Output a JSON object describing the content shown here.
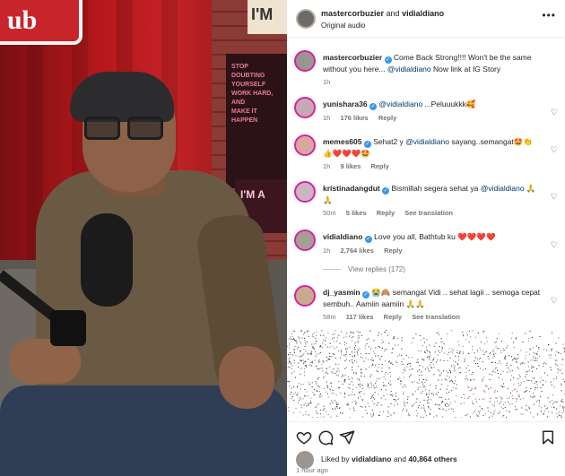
{
  "colors": {
    "text": "#262626",
    "secondary": "#737373",
    "mention": "#00376b",
    "verified": "#3897f0",
    "heart_red": "#ed1d25"
  },
  "media": {
    "left_sign_text": "ub",
    "right_sign_text": "I'M",
    "poster_text": [
      "STOP DOUBTING",
      "YOURSELF",
      "WORK HARD, AND",
      "MAKE IT HAPPEN"
    ],
    "poster2_text": "I'M A"
  },
  "header": {
    "user1": "mastercorbuzier",
    "and": "and",
    "user2": "vidialdiano",
    "audio_label": "Original audio",
    "more_icon": "more-horizontal-icon"
  },
  "caption": {
    "username": "mastercorbuzier",
    "text_before": "Come Back Strong!!!! Won't be the same without you here...",
    "mention": "@vidialdiano",
    "text_after": "Now link at IG Story",
    "time": "1h"
  },
  "comments": [
    {
      "username": "yunishara36",
      "verified": true,
      "mention": "@vidialdiano",
      "text": "...Peluuukkk🥰",
      "time": "1h",
      "likes": "176 likes",
      "reply": "Reply",
      "translation": ""
    },
    {
      "username": "memes605",
      "verified": true,
      "text_before": "Sehat2 y",
      "mention": "@vidialdiano",
      "text": "sayang..semangat🤩👏",
      "line2": "👍❤️❤️❤️🤩",
      "time": "1h",
      "likes": "9 likes",
      "reply": "Reply",
      "translation": ""
    },
    {
      "username": "kristinadangdut",
      "verified": true,
      "text_before": "Bismillah segera sehat ya",
      "mention": "@vidialdiano",
      "text": "🙏",
      "line2": "🙏",
      "time": "50m",
      "likes": "5 likes",
      "reply": "Reply",
      "translation": "See translation"
    },
    {
      "username": "vidialdiano",
      "verified": true,
      "text": "Love you all, Bathtub ku ❤️❤️❤️❤️",
      "time": "1h",
      "likes": "2,764 likes",
      "reply": "Reply",
      "translation": ""
    },
    {
      "username": "dj_yasmin",
      "verified": true,
      "text": "😭🙈 semangat Vidi .. sehat lagii .. semoga cepat sembuh.. Aamiin aamiin 🙏🙏",
      "time": "58m",
      "likes": "117 likes",
      "reply": "Reply",
      "translation": "See translation"
    }
  ],
  "view_replies": "View replies (172)",
  "footer": {
    "liked_by_prefix": "Liked by",
    "liked_by_user": "vidialdiano",
    "liked_by_and": "and",
    "liked_by_count": "40,864 others",
    "time": "1 hour ago",
    "icons": [
      "heart-icon",
      "comment-icon",
      "share-icon",
      "bookmark-icon"
    ]
  }
}
